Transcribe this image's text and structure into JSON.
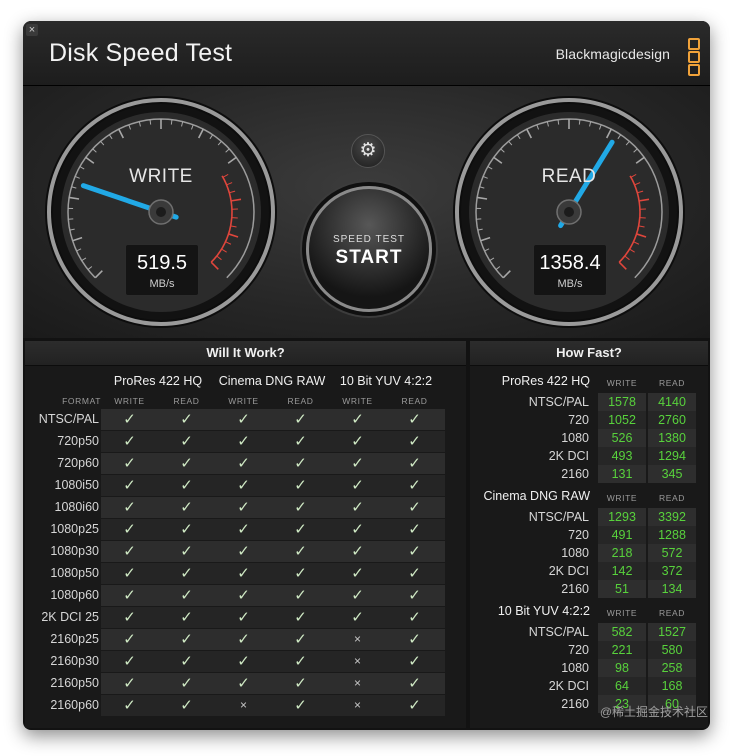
{
  "window": {
    "title": "Disk Speed Test",
    "brand": "Blackmagicdesign",
    "close_glyph": "×"
  },
  "gauges": {
    "write": {
      "label": "WRITE",
      "value": "519.5",
      "unit": "MB/s"
    },
    "read": {
      "label": "READ",
      "value": "1358.4",
      "unit": "MB/s"
    }
  },
  "controls": {
    "settings_icon": "gear-icon",
    "settings_glyph": "⚙",
    "start_sub": "SPEED TEST",
    "start_main": "START"
  },
  "will_it_work": {
    "title": "Will It Work?",
    "format_label": "FORMAT",
    "columns": [
      "ProRes 422 HQ",
      "Cinema DNG RAW",
      "10 Bit YUV 4:2:2"
    ],
    "sub": [
      "WRITE",
      "READ"
    ],
    "rows": [
      {
        "label": "NTSC/PAL",
        "cells": [
          "✓",
          "✓",
          "✓",
          "✓",
          "✓",
          "✓"
        ]
      },
      {
        "label": "720p50",
        "cells": [
          "✓",
          "✓",
          "✓",
          "✓",
          "✓",
          "✓"
        ]
      },
      {
        "label": "720p60",
        "cells": [
          "✓",
          "✓",
          "✓",
          "✓",
          "✓",
          "✓"
        ]
      },
      {
        "label": "1080i50",
        "cells": [
          "✓",
          "✓",
          "✓",
          "✓",
          "✓",
          "✓"
        ]
      },
      {
        "label": "1080i60",
        "cells": [
          "✓",
          "✓",
          "✓",
          "✓",
          "✓",
          "✓"
        ]
      },
      {
        "label": "1080p25",
        "cells": [
          "✓",
          "✓",
          "✓",
          "✓",
          "✓",
          "✓"
        ]
      },
      {
        "label": "1080p30",
        "cells": [
          "✓",
          "✓",
          "✓",
          "✓",
          "✓",
          "✓"
        ]
      },
      {
        "label": "1080p50",
        "cells": [
          "✓",
          "✓",
          "✓",
          "✓",
          "✓",
          "✓"
        ]
      },
      {
        "label": "1080p60",
        "cells": [
          "✓",
          "✓",
          "✓",
          "✓",
          "✓",
          "✓"
        ]
      },
      {
        "label": "2K DCI 25",
        "cells": [
          "✓",
          "✓",
          "✓",
          "✓",
          "✓",
          "✓"
        ]
      },
      {
        "label": "2160p25",
        "cells": [
          "✓",
          "✓",
          "✓",
          "✓",
          "×",
          "✓"
        ]
      },
      {
        "label": "2160p30",
        "cells": [
          "✓",
          "✓",
          "✓",
          "✓",
          "×",
          "✓"
        ]
      },
      {
        "label": "2160p50",
        "cells": [
          "✓",
          "✓",
          "✓",
          "✓",
          "×",
          "✓"
        ]
      },
      {
        "label": "2160p60",
        "cells": [
          "✓",
          "✓",
          "×",
          "✓",
          "×",
          "✓"
        ]
      }
    ]
  },
  "how_fast": {
    "title": "How Fast?",
    "sub": [
      "WRITE",
      "READ"
    ],
    "groups": [
      {
        "title": "ProRes 422 HQ",
        "rows": [
          {
            "label": "NTSC/PAL",
            "write": "1578",
            "read": "4140"
          },
          {
            "label": "720",
            "write": "1052",
            "read": "2760"
          },
          {
            "label": "1080",
            "write": "526",
            "read": "1380"
          },
          {
            "label": "2K DCI",
            "write": "493",
            "read": "1294"
          },
          {
            "label": "2160",
            "write": "131",
            "read": "345"
          }
        ]
      },
      {
        "title": "Cinema DNG RAW",
        "rows": [
          {
            "label": "NTSC/PAL",
            "write": "1293",
            "read": "3392"
          },
          {
            "label": "720",
            "write": "491",
            "read": "1288"
          },
          {
            "label": "1080",
            "write": "218",
            "read": "572"
          },
          {
            "label": "2K DCI",
            "write": "142",
            "read": "372"
          },
          {
            "label": "2160",
            "write": "51",
            "read": "134"
          }
        ]
      },
      {
        "title": "10 Bit YUV 4:2:2",
        "rows": [
          {
            "label": "NTSC/PAL",
            "write": "582",
            "read": "1527"
          },
          {
            "label": "720",
            "write": "221",
            "read": "580"
          },
          {
            "label": "1080",
            "write": "98",
            "read": "258"
          },
          {
            "label": "2K DCI",
            "write": "64",
            "read": "168"
          },
          {
            "label": "2160",
            "write": "23",
            "read": "60"
          }
        ]
      }
    ]
  },
  "watermark": "@稀土掘金技术社区",
  "colors": {
    "accent_needle": "#21a9e6",
    "value_green": "#58d23c",
    "brand_orange": "#f0a23a",
    "redline": "#e0463c"
  }
}
